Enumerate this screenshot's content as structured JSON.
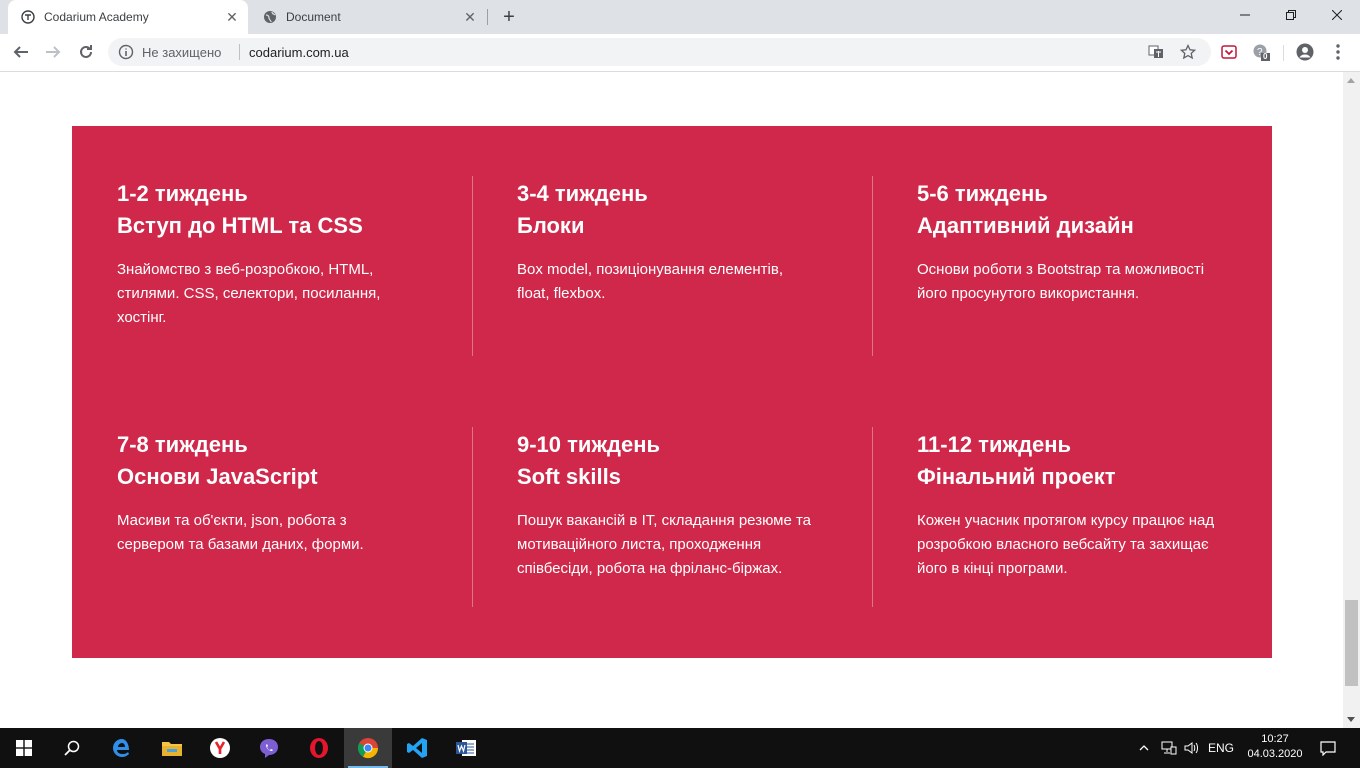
{
  "browser": {
    "tabs": [
      {
        "title": "Codarium Academy",
        "icon": "codarium-favicon"
      },
      {
        "title": "Document",
        "icon": "globe-icon"
      }
    ],
    "new_tab_label": "+",
    "security_text": "Не захищено",
    "url": "codarium.com.ua",
    "extension_badge": "0"
  },
  "program": {
    "background_color": "#cf284a",
    "modules": [
      {
        "weeks": "1-2 тиждень",
        "title": "Вступ до HTML та CSS",
        "description": "Знайомство з веб-розробкою, HTML, стилями. CSS, селектори, посилання, хостінг."
      },
      {
        "weeks": "3-4 тиждень",
        "title": "Блоки",
        "description": "Box model, позиціонування елементів, float, flexbox."
      },
      {
        "weeks": "5-6 тиждень",
        "title": "Адаптивний дизайн",
        "description": "Основи роботи з Bootstrap та можливості його просунутого використання."
      },
      {
        "weeks": "7-8 тиждень",
        "title": "Основи JavaScript",
        "description": "Масиви та об'єкти, json, робота з сервером та базами даних, форми."
      },
      {
        "weeks": "9-10 тиждень",
        "title": "Soft skills",
        "description": "Пошук вакансій в IT, складання резюме та мотиваційного листа, проходження співбесіди, робота на фріланс-біржах."
      },
      {
        "weeks": "11-12 тиждень",
        "title": "Фінальний проект",
        "description": "Кожен учасник протягом курсу працює над розробкою власного вебсайту та захищає його в кінці програми."
      }
    ]
  },
  "taskbar": {
    "apps": [
      "windows-start-icon",
      "search-icon",
      "edge-icon",
      "file-explorer-icon",
      "yandex-browser-icon",
      "viber-icon",
      "opera-icon",
      "chrome-icon",
      "vscode-icon",
      "word-icon"
    ],
    "language": "ENG",
    "time": "10:27",
    "date": "04.03.2020"
  }
}
